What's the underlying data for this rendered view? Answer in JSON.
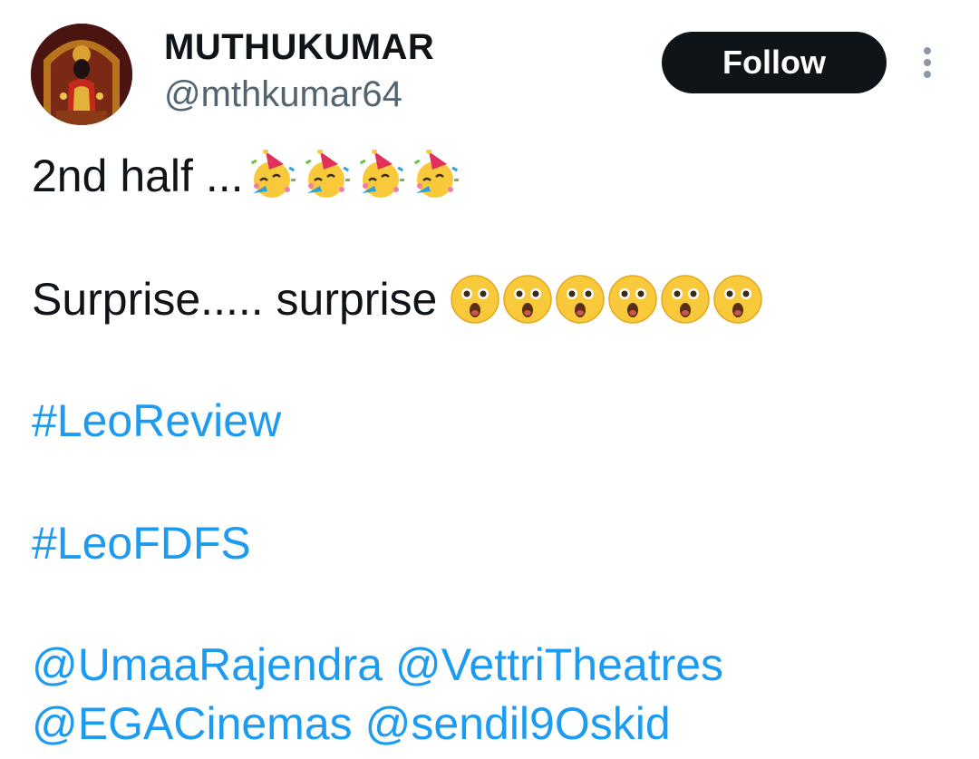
{
  "author": {
    "display_name": "MUTHUKUMAR",
    "handle": "@mthkumar64",
    "avatar_icon": "deity-portrait-avatar"
  },
  "actions": {
    "follow_label": "Follow",
    "more_icon": "more-vertical-icon"
  },
  "tweet": {
    "line1_text": "2nd half ...",
    "line1_emoji": "partying-face-emoji",
    "line1_emoji_count": 4,
    "line2_text": "Surprise..... surprise",
    "line2_emoji": "hushed-face-emoji",
    "line2_emoji_count": 6,
    "hashtags": [
      "#LeoReview",
      "#LeoFDFS"
    ],
    "mentions": [
      "@UmaaRajendra",
      "@VettriTheatres",
      "@EGACinemas",
      "@sendil9Oskid"
    ]
  },
  "colors": {
    "text": "#0f1419",
    "secondary": "#536471",
    "link": "#1d9bf0",
    "button_bg": "#0f1419"
  }
}
